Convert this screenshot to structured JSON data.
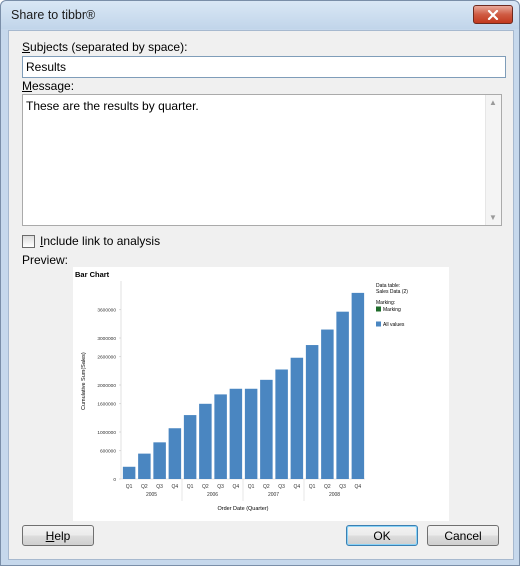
{
  "window": {
    "title": "Share to tibbr®"
  },
  "subjects": {
    "label": "Subjects (separated by space):",
    "value": "Results"
  },
  "message": {
    "label": "Message:",
    "value": "These are the results by quarter."
  },
  "include_link": {
    "label": "Include link to analysis",
    "checked": false
  },
  "preview": {
    "label": "Preview:"
  },
  "chart": {
    "title": "Bar Chart",
    "legend": {
      "data_table_label": "Data table:",
      "data_table_value": "Sales Data (2)",
      "marking_label": "Marking:",
      "marking_value": "Marking",
      "marking_color": "#1e6b2a",
      "series_label": "All values",
      "series_color": "#4a86c1"
    }
  },
  "chart_data": {
    "type": "bar",
    "title": "Bar Chart",
    "xlabel": "Order Date (Quarter)",
    "ylabel": "Cumulative Sum(Sales)",
    "categories": [
      "Q1",
      "Q2",
      "Q3",
      "Q4",
      "Q1",
      "Q2",
      "Q3",
      "Q4",
      "Q1",
      "Q2",
      "Q3",
      "Q4",
      "Q1",
      "Q2",
      "Q3",
      "Q4"
    ],
    "year_groups": [
      {
        "label": "2005",
        "count": 4
      },
      {
        "label": "2006",
        "count": 4
      },
      {
        "label": "2007",
        "count": 4
      },
      {
        "label": "2008",
        "count": 4
      }
    ],
    "series": [
      {
        "name": "All values",
        "values": [
          260000,
          540000,
          780000,
          1080000,
          1360000,
          1600000,
          1800000,
          1920000,
          1920000,
          2110000,
          2330000,
          2580000,
          2850000,
          3180000,
          3560000,
          3960000
        ]
      }
    ],
    "yticks": [
      0,
      600000,
      1000000,
      1600000,
      2000000,
      2600000,
      3000000,
      3600000
    ],
    "ytick_labels": [
      "0",
      "600000",
      "1000000",
      "1600000",
      "2000000",
      "2600000",
      "3000000",
      "3600000"
    ],
    "ylim": [
      0,
      4000000
    ],
    "legend_position": "right",
    "grid": false
  },
  "buttons": {
    "help": "Help",
    "ok": "OK",
    "cancel": "Cancel"
  }
}
